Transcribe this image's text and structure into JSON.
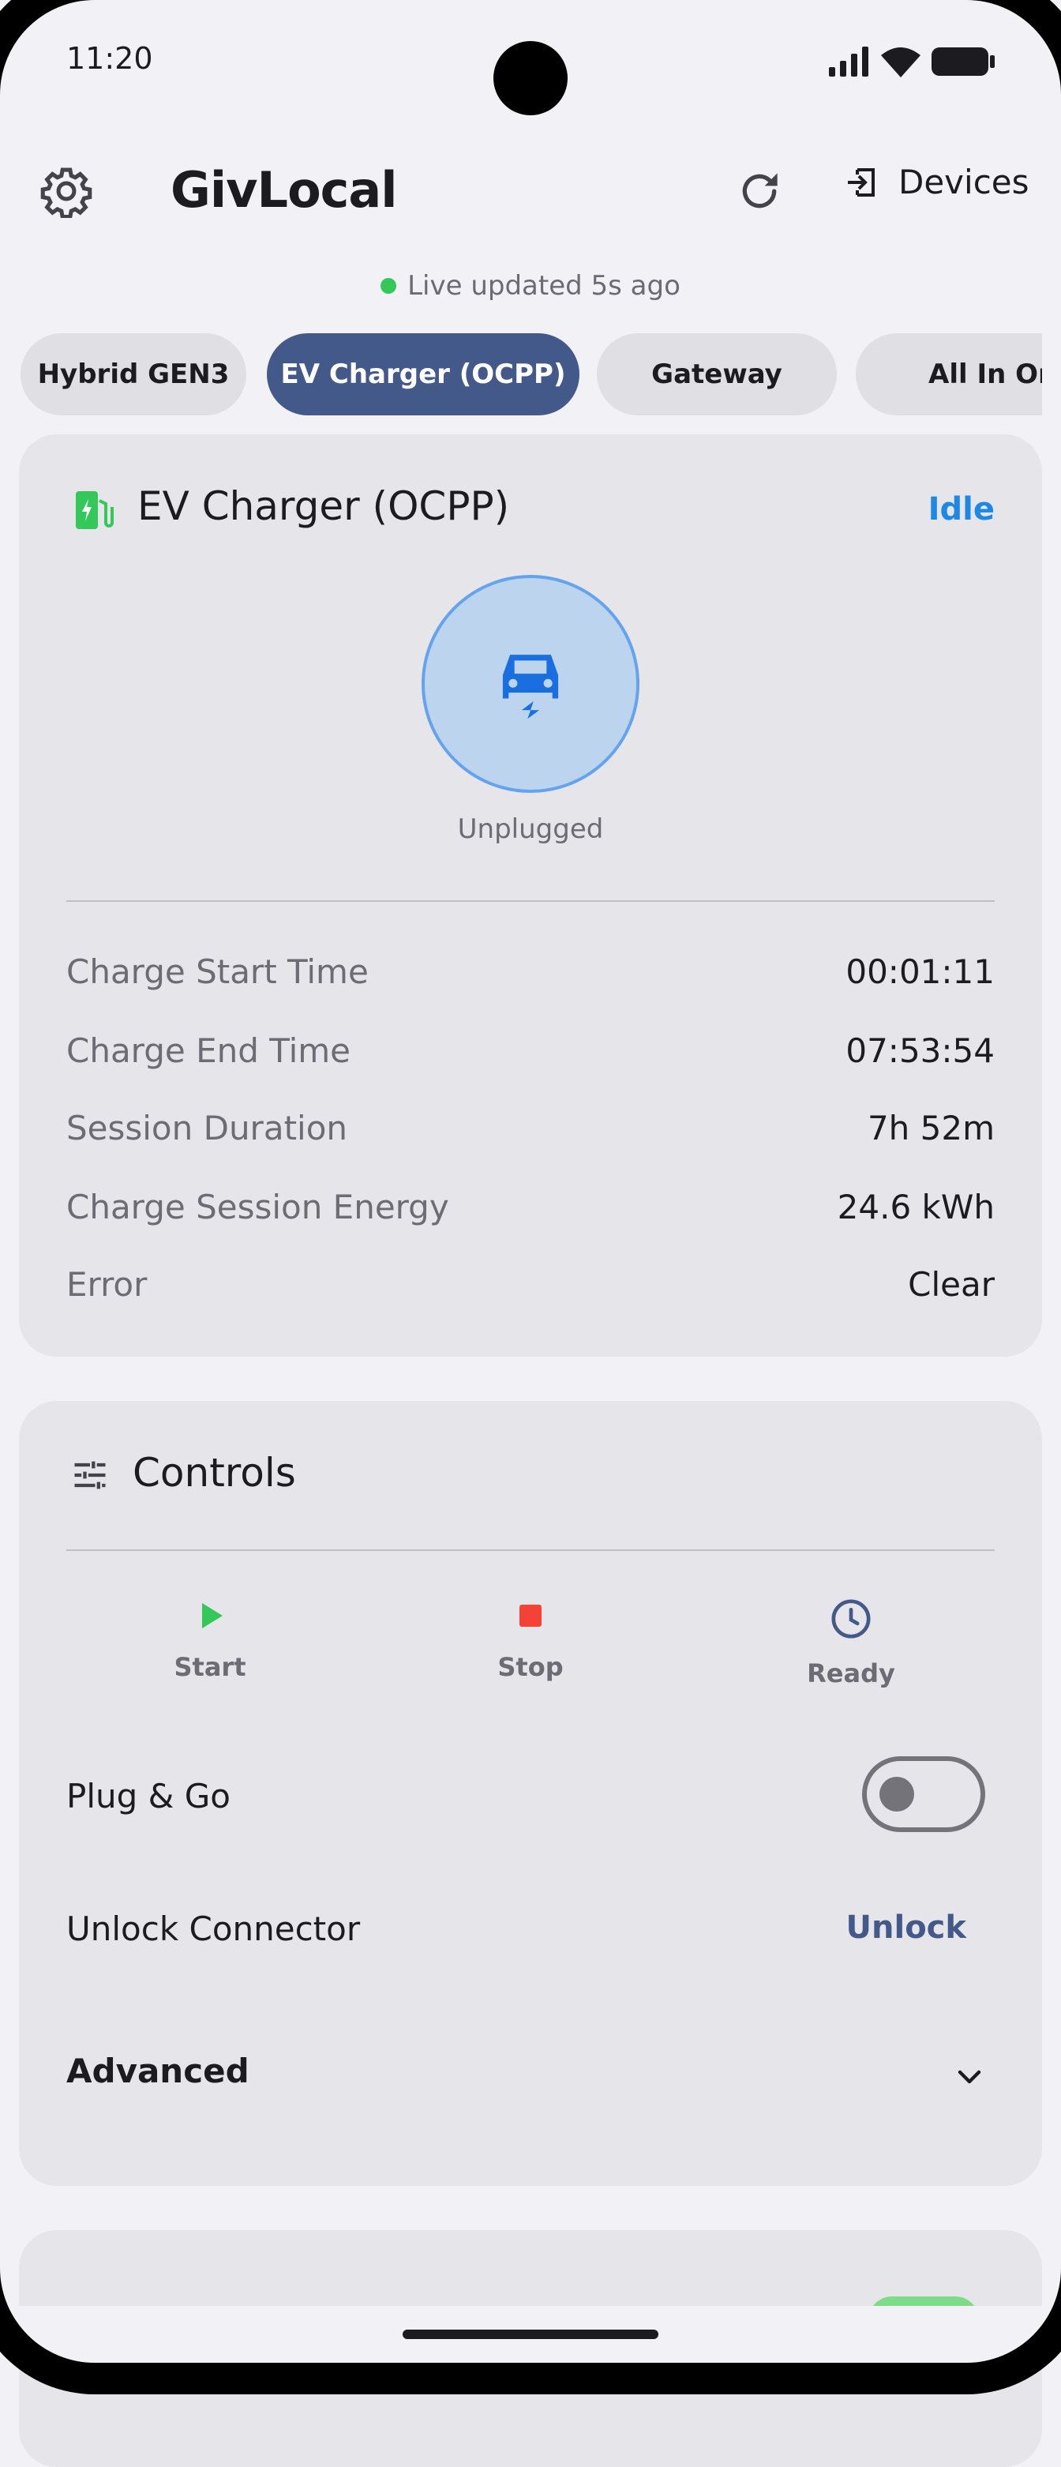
{
  "status_bar": {
    "time": "11:20"
  },
  "app_bar": {
    "title": "GivLocal",
    "devices_label": "Devices"
  },
  "live_status": {
    "text": "Live updated 5s ago"
  },
  "tabs": [
    {
      "label": "Hybrid GEN3",
      "active": false
    },
    {
      "label": "EV Charger (OCPP)",
      "active": true
    },
    {
      "label": "Gateway",
      "active": false
    },
    {
      "label": "All In One",
      "active": false
    }
  ],
  "ev_card": {
    "title": "EV Charger (OCPP)",
    "status": "Idle",
    "plug_state": "Unplugged",
    "rows": [
      {
        "label": "Charge Start Time",
        "value": "00:01:11"
      },
      {
        "label": "Charge End Time",
        "value": "07:53:54"
      },
      {
        "label": "Session Duration",
        "value": "7h 52m"
      },
      {
        "label": "Charge Session Energy",
        "value": "24.6 kWh"
      },
      {
        "label": "Error",
        "value": "Clear"
      }
    ]
  },
  "controls": {
    "title": "Controls",
    "start_label": "Start",
    "stop_label": "Stop",
    "ready_label": "Ready",
    "plug_go_label": "Plug & Go",
    "plug_go_enabled": false,
    "unlock_connector_label": "Unlock Connector",
    "unlock_button": "Unlock",
    "advanced_label": "Advanced"
  },
  "colors": {
    "accent": "#43598a",
    "idle": "#1e88e5",
    "start": "#34c759",
    "stop": "#f44336",
    "live_dot": "#34c759"
  }
}
